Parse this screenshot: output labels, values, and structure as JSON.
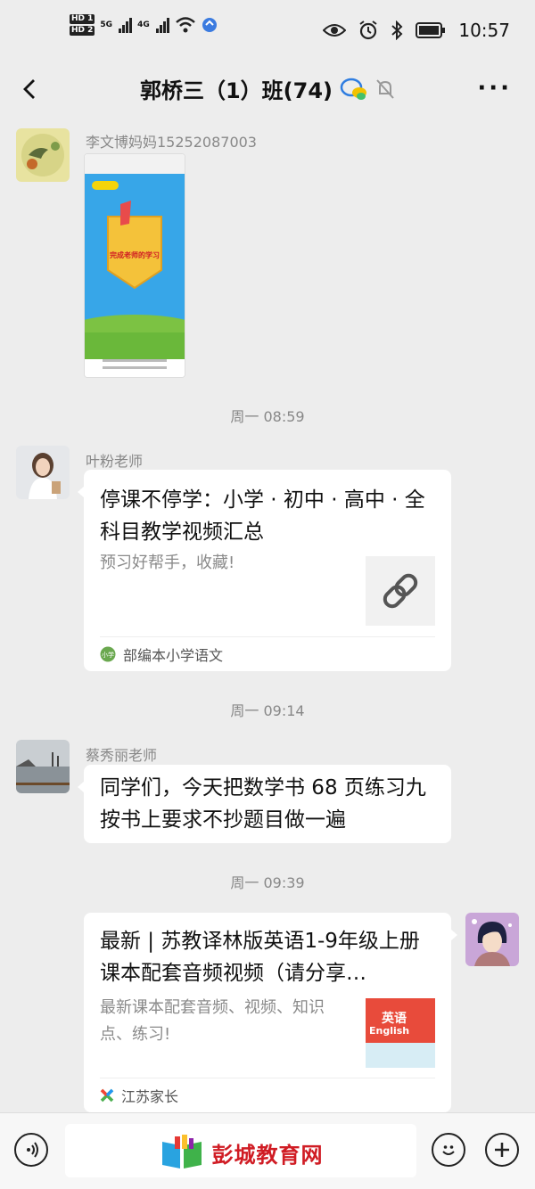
{
  "status_bar": {
    "hd1": "HD 1",
    "hd2": "HD 2",
    "net1": "5G",
    "net2": "4G",
    "time": "10:57"
  },
  "header": {
    "title": "郭桥三（1）班(74)"
  },
  "messages": [
    {
      "sender": "李文博妈妈15252087003",
      "type": "image",
      "image_caption": "完成老师的学习"
    },
    {
      "time": "周一 08:59"
    },
    {
      "sender": "叶粉老师",
      "type": "link",
      "title": "停课不停学：小学 · 初中 · 高中 · 全科目教学视频汇总",
      "desc": "预习好帮手，收藏!",
      "source": "部编本小学语文"
    },
    {
      "time": "周一 09:14"
    },
    {
      "sender": "蔡秀丽老师",
      "type": "text",
      "text": "同学们，今天把数学书 68 页练习九按书上要求不抄题目做一遍"
    },
    {
      "time": "周一 09:39"
    },
    {
      "sender": "",
      "type": "link",
      "title": "最新 | 苏教译林版英语1-9年级上册课本配套音频视频（请分享…",
      "desc": "最新课本配套音频、视频、知识点、练习!",
      "source": "江苏家长",
      "thumb_title": "英语",
      "thumb_sub": "English"
    }
  ],
  "bottom_bar": {
    "watermark": "彭城教育网"
  },
  "colors": {
    "background": "#ededed",
    "bubble": "#ffffff",
    "watermark": "#d01c24"
  }
}
